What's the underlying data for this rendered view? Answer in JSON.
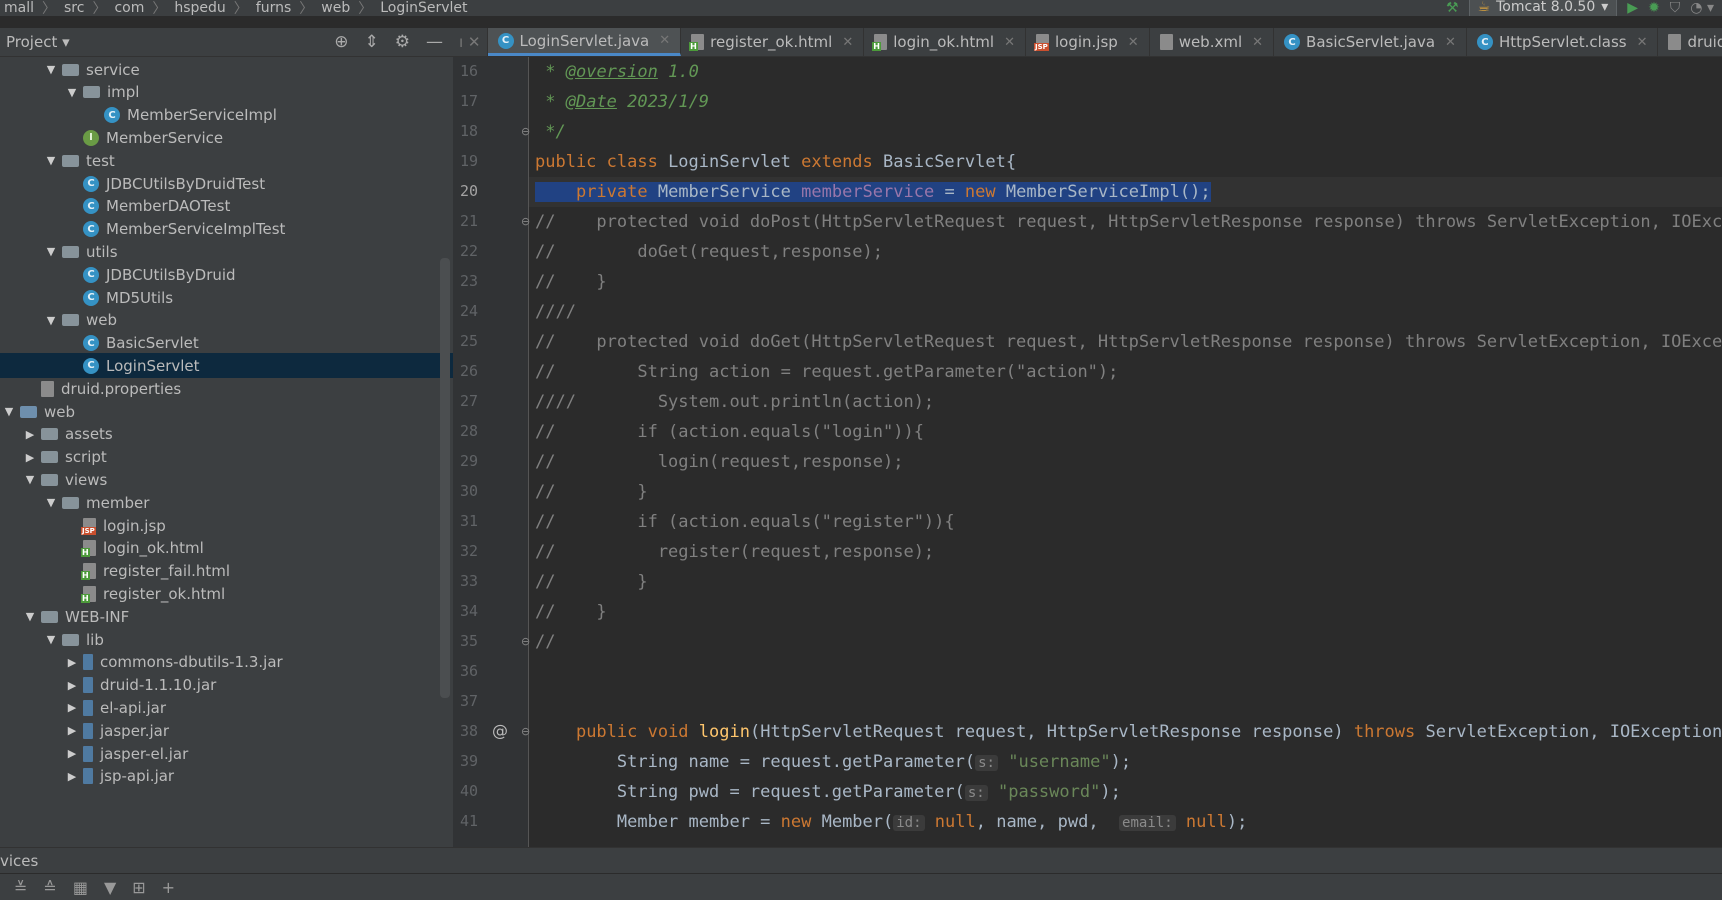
{
  "breadcrumb": [
    "mall",
    "src",
    "com",
    "hspedu",
    "furns",
    "web",
    "LoginServlet"
  ],
  "run_config": "Tomcat 8.0.50",
  "project": {
    "label": "Project"
  },
  "tree": [
    {
      "label": "service",
      "icon": "folder",
      "depth": 2,
      "arrow": "down"
    },
    {
      "label": "impl",
      "icon": "folder",
      "depth": 3,
      "arrow": "down"
    },
    {
      "label": "MemberServiceImpl",
      "icon": "class",
      "depth": 4,
      "arrow": ""
    },
    {
      "label": "MemberService",
      "icon": "iface",
      "depth": 3,
      "arrow": ""
    },
    {
      "label": "test",
      "icon": "folder",
      "depth": 2,
      "arrow": "down"
    },
    {
      "label": "JDBCUtilsByDruidTest",
      "icon": "class",
      "depth": 3,
      "arrow": ""
    },
    {
      "label": "MemberDAOTest",
      "icon": "class",
      "depth": 3,
      "arrow": ""
    },
    {
      "label": "MemberServiceImplTest",
      "icon": "class",
      "depth": 3,
      "arrow": ""
    },
    {
      "label": "utils",
      "icon": "folder",
      "depth": 2,
      "arrow": "down"
    },
    {
      "label": "JDBCUtilsByDruid",
      "icon": "class",
      "depth": 3,
      "arrow": ""
    },
    {
      "label": "MD5Utils",
      "icon": "class",
      "depth": 3,
      "arrow": ""
    },
    {
      "label": "web",
      "icon": "folder",
      "depth": 2,
      "arrow": "down"
    },
    {
      "label": "BasicServlet",
      "icon": "class",
      "depth": 3,
      "arrow": ""
    },
    {
      "label": "LoginServlet",
      "icon": "class",
      "depth": 3,
      "arrow": "",
      "selected": true
    },
    {
      "label": "druid.properties",
      "icon": "props",
      "depth": 1,
      "arrow": ""
    },
    {
      "label": "web",
      "icon": "folder-web",
      "depth": 0,
      "arrow": "down"
    },
    {
      "label": "assets",
      "icon": "folder",
      "depth": 1,
      "arrow": "right"
    },
    {
      "label": "script",
      "icon": "folder",
      "depth": 1,
      "arrow": "right"
    },
    {
      "label": "views",
      "icon": "folder",
      "depth": 1,
      "arrow": "down"
    },
    {
      "label": "member",
      "icon": "folder",
      "depth": 2,
      "arrow": "down"
    },
    {
      "label": "login.jsp",
      "icon": "jsp",
      "depth": 3,
      "arrow": ""
    },
    {
      "label": "login_ok.html",
      "icon": "html",
      "depth": 3,
      "arrow": ""
    },
    {
      "label": "register_fail.html",
      "icon": "html",
      "depth": 3,
      "arrow": ""
    },
    {
      "label": "register_ok.html",
      "icon": "html",
      "depth": 3,
      "arrow": ""
    },
    {
      "label": "WEB-INF",
      "icon": "folder",
      "depth": 1,
      "arrow": "down"
    },
    {
      "label": "lib",
      "icon": "folder",
      "depth": 2,
      "arrow": "down"
    },
    {
      "label": "commons-dbutils-1.3.jar",
      "icon": "jar",
      "depth": 3,
      "arrow": "right"
    },
    {
      "label": "druid-1.1.10.jar",
      "icon": "jar",
      "depth": 3,
      "arrow": "right"
    },
    {
      "label": "el-api.jar",
      "icon": "jar",
      "depth": 3,
      "arrow": "right"
    },
    {
      "label": "jasper.jar",
      "icon": "jar",
      "depth": 3,
      "arrow": "right"
    },
    {
      "label": "jasper-el.jar",
      "icon": "jar",
      "depth": 3,
      "arrow": "right"
    },
    {
      "label": "jsp-api.jar",
      "icon": "jar",
      "depth": 3,
      "arrow": "right"
    }
  ],
  "tabs": [
    {
      "label": "LoginServlet.java",
      "icon": "class",
      "active": true
    },
    {
      "label": "register_ok.html",
      "icon": "html",
      "active": false
    },
    {
      "label": "login_ok.html",
      "icon": "html",
      "active": false
    },
    {
      "label": "login.jsp",
      "icon": "jsp",
      "active": false
    },
    {
      "label": "web.xml",
      "icon": "file",
      "active": false
    },
    {
      "label": "BasicServlet.java",
      "icon": "class",
      "active": false
    },
    {
      "label": "HttpServlet.class",
      "icon": "class",
      "active": false
    },
    {
      "label": "druid.properties",
      "icon": "props",
      "active": false
    }
  ],
  "editor": {
    "current_line": 20,
    "lines": [
      {
        "n": 16,
        "html": " <span class=\"cmi\">* </span><span class=\"ann\">@oversion</span><span class=\"cmi\"> 1.0</span>"
      },
      {
        "n": 17,
        "html": " <span class=\"cmi\">* </span><span class=\"ann\">@Date</span><span class=\"cmi\"> 2023/1/9</span>"
      },
      {
        "n": 18,
        "html": " <span class=\"cmi\">*/</span>",
        "mark": "fold"
      },
      {
        "n": 19,
        "html": "<span class=\"kw\">public class </span>LoginServlet <span class=\"kw\">extends </span>BasicServlet{"
      },
      {
        "n": 20,
        "html": "<span class=\"sel\">    <span class=\"kw\">private </span>MemberService <span class=\"fld\">memberService</span> = <span class=\"kw\">new </span>MemberServiceImpl();</span>",
        "current": true
      },
      {
        "n": 21,
        "html": "<span class=\"cm\">//    protected void doPost(HttpServletRequest request, HttpServletResponse response) throws ServletException, IOException {</span>",
        "mark": "fold"
      },
      {
        "n": 22,
        "html": "<span class=\"cm\">//        doGet(request,response);</span>"
      },
      {
        "n": 23,
        "html": "<span class=\"cm\">//    }</span>"
      },
      {
        "n": 24,
        "html": "<span class=\"cm\">////</span>"
      },
      {
        "n": 25,
        "html": "<span class=\"cm\">//    protected void doGet(HttpServletRequest request, HttpServletResponse response) throws ServletException, IOException {</span>"
      },
      {
        "n": 26,
        "html": "<span class=\"cm\">//        String action = request.getParameter(\"action\");</span>"
      },
      {
        "n": 27,
        "html": "<span class=\"cm\">////        System.out.println(action);</span>"
      },
      {
        "n": 28,
        "html": "<span class=\"cm\">//        if (action.equals(\"login\")){</span>"
      },
      {
        "n": 29,
        "html": "<span class=\"cm\">//          login(request,response);</span>"
      },
      {
        "n": 30,
        "html": "<span class=\"cm\">//        }</span>"
      },
      {
        "n": 31,
        "html": "<span class=\"cm\">//        if (action.equals(\"register\")){</span>"
      },
      {
        "n": 32,
        "html": "<span class=\"cm\">//          register(request,response);</span>"
      },
      {
        "n": 33,
        "html": "<span class=\"cm\">//        }</span>"
      },
      {
        "n": 34,
        "html": "<span class=\"cm\">//    }</span>"
      },
      {
        "n": 35,
        "html": "<span class=\"cm\">//</span>",
        "mark": "fold"
      },
      {
        "n": 36,
        "html": ""
      },
      {
        "n": 37,
        "html": ""
      },
      {
        "n": 38,
        "html": "    <span class=\"kw\">public void </span><span class=\"meth\">login</span>(HttpServletRequest request, HttpServletResponse response) <span class=\"kw\">throws </span>ServletException, IOException {",
        "mark": "fold",
        "at": true
      },
      {
        "n": 39,
        "html": "        String name = request.getParameter(<span class=\"hint\">s:</span> <span class=\"str\">\"username\"</span>);"
      },
      {
        "n": 40,
        "html": "        String pwd = request.getParameter(<span class=\"hint\">s:</span> <span class=\"str\">\"password\"</span>);"
      },
      {
        "n": 41,
        "html": "        Member member = <span class=\"kw\">new </span>Member(<span class=\"hint\">id:</span> <span class=\"kw\">null</span>, name, pwd,  <span class=\"hint\">email:</span> <span class=\"kw\">null</span>);"
      }
    ]
  },
  "bottom": {
    "services_label": "vices",
    "tool_icons": [
      "expand-all-icon",
      "collapse-all-icon",
      "group-icon",
      "filter-icon",
      "new-service-icon",
      "add-icon"
    ]
  }
}
